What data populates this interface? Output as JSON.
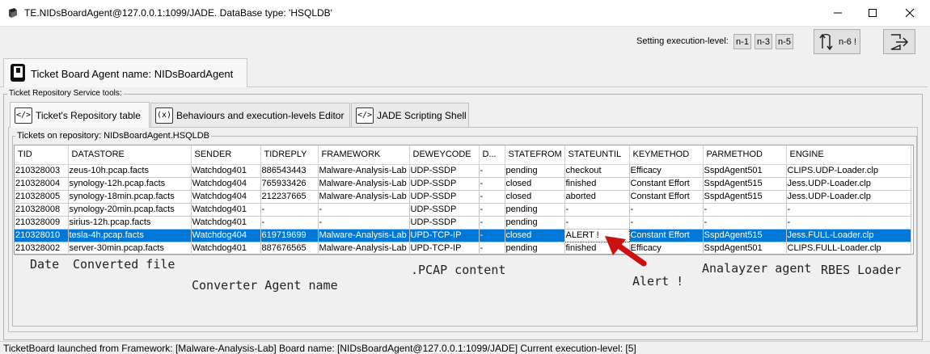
{
  "window": {
    "title": "TE.NIDsBoardAgent@127.0.0.1:1099/JADE. DataBase type: 'HSQLDB'"
  },
  "toolbar": {
    "exec_label": "Setting execution-level:",
    "levels": [
      "n-1",
      "n-3",
      "n-5"
    ],
    "n6_label": "n-6 !"
  },
  "agent_tab": {
    "label": "Ticket Board Agent name: NIDsBoardAgent"
  },
  "service_tools": {
    "title": "Ticket Repository Service tools:",
    "tabs": [
      {
        "label": "Ticket's Repository table",
        "icon": "</>"
      },
      {
        "label": "Behaviours and execution-levels Editor",
        "icon": "(x)"
      },
      {
        "label": "JADE Scripting Shell",
        "icon": "</>"
      }
    ]
  },
  "tickets": {
    "title": "Tickets on repository: NIDsBoardAgent.HSQLDB",
    "columns": [
      "TID",
      "DATASTORE",
      "SENDER",
      "TIDREPLY",
      "FRAMEWORK",
      "DEWEYCODE",
      "D...",
      "STATEFROM",
      "STATEUNTIL",
      "KEYMETHOD",
      "PARMETHOD",
      "ENGINE"
    ],
    "rows": [
      [
        "210328003",
        "zeus-10h.pcap.facts",
        "Watchdog401",
        "886543443",
        "Malware-Analysis-Lab",
        "UDP-SSDP",
        "-",
        "pending",
        "checkout",
        "Efficacy",
        "SspdAgent501",
        "CLIPS.UDP-Loader.clp"
      ],
      [
        "210328004",
        "synology-12h.pcap.facts",
        "Watchdog404",
        "765933426",
        "Malware-Analysis-Lab",
        "UDP-SSDP",
        "-",
        "closed",
        "finished",
        "Constant Effort",
        "SspdAgent515",
        "Jess.UDP-Loader.clp"
      ],
      [
        "210328005",
        "synology-18min.pcap.facts",
        "Watchdog404",
        "212237665",
        "Malware-Analysis-Lab",
        "UDP-SSDP",
        "-",
        "closed",
        "aborted",
        "Constant Effort",
        "SspdAgent515",
        "Jess.UDP-Loader.clp"
      ],
      [
        "210328008",
        "synology-20min.pcap.facts",
        "Watchdog401",
        "-",
        "-",
        "UDP-SSDP",
        "-",
        "pending",
        "-",
        "-",
        "-",
        "-"
      ],
      [
        "210328009",
        "sirius-12h.pcap.facts",
        "Watchdog401",
        "-",
        "-",
        "UDP-SSDP",
        "-",
        "pending",
        "-",
        "-",
        "-",
        "-"
      ],
      [
        "210328010",
        "tesla-4h.pcap.facts",
        "Watchdog404",
        "619719699",
        "Malware-Analysis-Lab",
        "UPD-TCP-IP",
        "-",
        "closed",
        "ALERT !",
        "Constant Effort",
        "SspdAgent515",
        "Jess.FULL-Loader.clp"
      ],
      [
        "210328002",
        "server-30min.pcap.facts",
        "Watchdog401",
        "887676565",
        "Malware-Analysis-Lab",
        "UPD-TCP-IP",
        "-",
        "pending",
        "finished",
        "Efficacy",
        "SspdAgent501",
        "CLIPS.FULL-Loader.clp"
      ]
    ],
    "selected_row": 5
  },
  "annotations": {
    "date": "Date",
    "converted": "Converted file",
    "converter": "Converter Agent name",
    "pcap": ".PCAP content",
    "alert": "Alert !",
    "analyzer": "Analayzer agent",
    "rbes": "RBES Loader"
  },
  "statusbar": {
    "text": "TicketBoard launched from Framework: [Malware-Analysis-Lab] Board name: [NIDsBoardAgent@127.0.0.1:1099/JADE] Current execution-level: [5]"
  },
  "colors": {
    "selection": "#0078d7",
    "arrow": "#cc1111"
  }
}
